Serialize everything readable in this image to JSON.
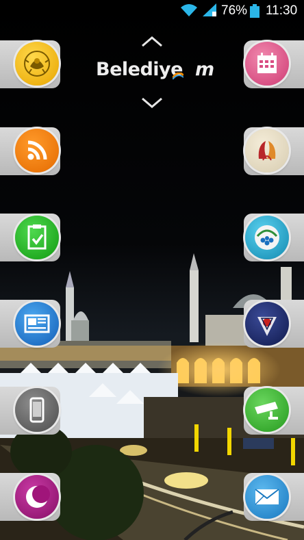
{
  "status_bar": {
    "battery_percent": "76%",
    "time": "11:30",
    "icons": [
      "wifi-icon",
      "signal-icon",
      "battery-icon"
    ]
  },
  "header": {
    "logo_text": "Belediye",
    "logo_mark": "m"
  },
  "navigation": {
    "up_icon": "chevron-up-icon",
    "down_icon": "chevron-down-icon"
  },
  "left_buttons": [
    {
      "icon": "state-emblem-icon",
      "color": "#f5b800"
    },
    {
      "icon": "rss-icon",
      "color": "#f07a00"
    },
    {
      "icon": "clipboard-check-icon",
      "color": "#1fae1f"
    },
    {
      "icon": "newspaper-icon",
      "color": "#1e7fd6"
    },
    {
      "icon": "smartphone-icon",
      "color": "#6e6e6e"
    },
    {
      "icon": "crescent-logo-icon",
      "color": "#a0157a"
    }
  ],
  "right_buttons": [
    {
      "icon": "calendar-icon",
      "color": "#e2588a"
    },
    {
      "icon": "municipality-logo-icon",
      "color": "#e8e0c8"
    },
    {
      "icon": "konya-logo-icon",
      "color": "#1aa6c8"
    },
    {
      "icon": "compass-emblem-icon",
      "color": "#1c2a6e"
    },
    {
      "icon": "security-camera-icon",
      "color": "#3cb534"
    },
    {
      "icon": "mail-icon",
      "color": "#2a9ad8"
    }
  ]
}
